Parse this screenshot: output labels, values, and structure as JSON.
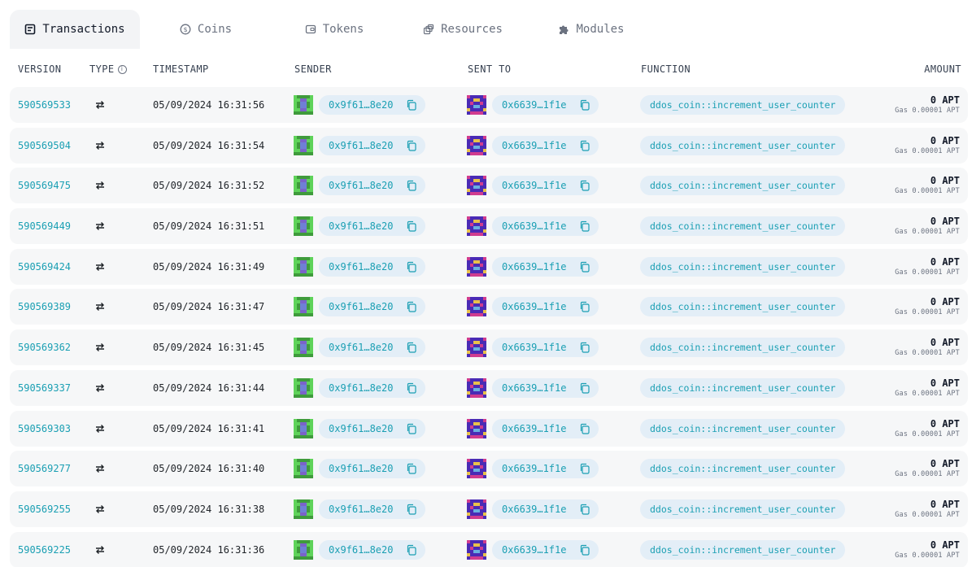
{
  "tabs": [
    {
      "label": "Transactions",
      "icon": "transactions-icon",
      "active": true
    },
    {
      "label": "Coins",
      "icon": "coin-icon",
      "active": false
    },
    {
      "label": "Tokens",
      "icon": "wallet-icon",
      "active": false
    },
    {
      "label": "Resources",
      "icon": "resources-icon",
      "active": false
    },
    {
      "label": "Modules",
      "icon": "puzzle-icon",
      "active": false
    }
  ],
  "table": {
    "headers": {
      "version": "VERSION",
      "type": "TYPE",
      "timestamp": "TIMESTAMP",
      "sender": "SENDER",
      "sent_to": "SENT TO",
      "function": "FUNCTION",
      "amount": "AMOUNT"
    },
    "rows": [
      {
        "version": "590569533",
        "timestamp": "05/09/2024 16:31:56",
        "sender": "0x9f61…8e20",
        "sent_to": "0x6639…1f1e",
        "function": "ddos_coin::increment_user_counter",
        "amount": "0 APT",
        "gas": "Gas 0.00001 APT"
      },
      {
        "version": "590569504",
        "timestamp": "05/09/2024 16:31:54",
        "sender": "0x9f61…8e20",
        "sent_to": "0x6639…1f1e",
        "function": "ddos_coin::increment_user_counter",
        "amount": "0 APT",
        "gas": "Gas 0.00001 APT"
      },
      {
        "version": "590569475",
        "timestamp": "05/09/2024 16:31:52",
        "sender": "0x9f61…8e20",
        "sent_to": "0x6639…1f1e",
        "function": "ddos_coin::increment_user_counter",
        "amount": "0 APT",
        "gas": "Gas 0.00001 APT"
      },
      {
        "version": "590569449",
        "timestamp": "05/09/2024 16:31:51",
        "sender": "0x9f61…8e20",
        "sent_to": "0x6639…1f1e",
        "function": "ddos_coin::increment_user_counter",
        "amount": "0 APT",
        "gas": "Gas 0.00001 APT"
      },
      {
        "version": "590569424",
        "timestamp": "05/09/2024 16:31:49",
        "sender": "0x9f61…8e20",
        "sent_to": "0x6639…1f1e",
        "function": "ddos_coin::increment_user_counter",
        "amount": "0 APT",
        "gas": "Gas 0.00001 APT"
      },
      {
        "version": "590569389",
        "timestamp": "05/09/2024 16:31:47",
        "sender": "0x9f61…8e20",
        "sent_to": "0x6639…1f1e",
        "function": "ddos_coin::increment_user_counter",
        "amount": "0 APT",
        "gas": "Gas 0.00001 APT"
      },
      {
        "version": "590569362",
        "timestamp": "05/09/2024 16:31:45",
        "sender": "0x9f61…8e20",
        "sent_to": "0x6639…1f1e",
        "function": "ddos_coin::increment_user_counter",
        "amount": "0 APT",
        "gas": "Gas 0.00001 APT"
      },
      {
        "version": "590569337",
        "timestamp": "05/09/2024 16:31:44",
        "sender": "0x9f61…8e20",
        "sent_to": "0x6639…1f1e",
        "function": "ddos_coin::increment_user_counter",
        "amount": "0 APT",
        "gas": "Gas 0.00001 APT"
      },
      {
        "version": "590569303",
        "timestamp": "05/09/2024 16:31:41",
        "sender": "0x9f61…8e20",
        "sent_to": "0x6639…1f1e",
        "function": "ddos_coin::increment_user_counter",
        "amount": "0 APT",
        "gas": "Gas 0.00001 APT"
      },
      {
        "version": "590569277",
        "timestamp": "05/09/2024 16:31:40",
        "sender": "0x9f61…8e20",
        "sent_to": "0x6639…1f1e",
        "function": "ddos_coin::increment_user_counter",
        "amount": "0 APT",
        "gas": "Gas 0.00001 APT"
      },
      {
        "version": "590569255",
        "timestamp": "05/09/2024 16:31:38",
        "sender": "0x9f61…8e20",
        "sent_to": "0x6639…1f1e",
        "function": "ddos_coin::increment_user_counter",
        "amount": "0 APT",
        "gas": "Gas 0.00001 APT"
      },
      {
        "version": "590569225",
        "timestamp": "05/09/2024 16:31:36",
        "sender": "0x9f61…8e20",
        "sent_to": "0x6639…1f1e",
        "function": "ddos_coin::increment_user_counter",
        "amount": "0 APT",
        "gas": "Gas 0.00001 APT"
      }
    ]
  },
  "colors": {
    "link": "#1a9fb3",
    "pill_bg": "#e3eef7",
    "row_bg": "#f6f7f8",
    "active_tab_bg": "#f3f4f6"
  }
}
